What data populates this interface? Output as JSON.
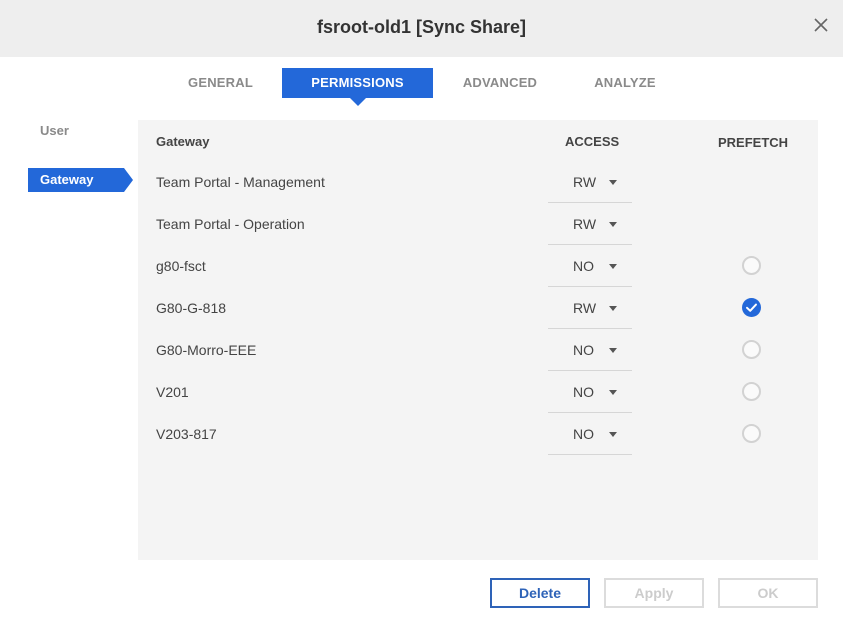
{
  "dialog": {
    "title": "fsroot-old1 [Sync Share]"
  },
  "tabs": [
    {
      "label": "GENERAL",
      "active": false
    },
    {
      "label": "PERMISSIONS",
      "active": true
    },
    {
      "label": "ADVANCED",
      "active": false
    },
    {
      "label": "ANALYZE",
      "active": false
    }
  ],
  "sidebar": {
    "items": [
      {
        "label": "User",
        "active": false
      },
      {
        "label": "Gateway",
        "active": true
      }
    ]
  },
  "table": {
    "columns": {
      "gateway": "Gateway",
      "access": "ACCESS",
      "prefetch": "PREFETCH"
    },
    "rows": [
      {
        "gateway": "Team Portal - Management",
        "access": "RW",
        "prefetch": null
      },
      {
        "gateway": "Team Portal - Operation",
        "access": "RW",
        "prefetch": null
      },
      {
        "gateway": "g80-fsct",
        "access": "NO",
        "prefetch": false
      },
      {
        "gateway": "G80-G-818",
        "access": "RW",
        "prefetch": true
      },
      {
        "gateway": "G80-Morro-EEE",
        "access": "NO",
        "prefetch": false
      },
      {
        "gateway": "V201",
        "access": "NO",
        "prefetch": false
      },
      {
        "gateway": "V203-817",
        "access": "NO",
        "prefetch": false
      }
    ]
  },
  "buttons": {
    "delete": "Delete",
    "apply": "Apply",
    "ok": "OK"
  },
  "colors": {
    "accent": "#2368d9",
    "delete_border": "#2e63b8"
  },
  "icons": {
    "close": "close-icon",
    "caret": "chevron-down-icon",
    "check": "check-icon"
  }
}
